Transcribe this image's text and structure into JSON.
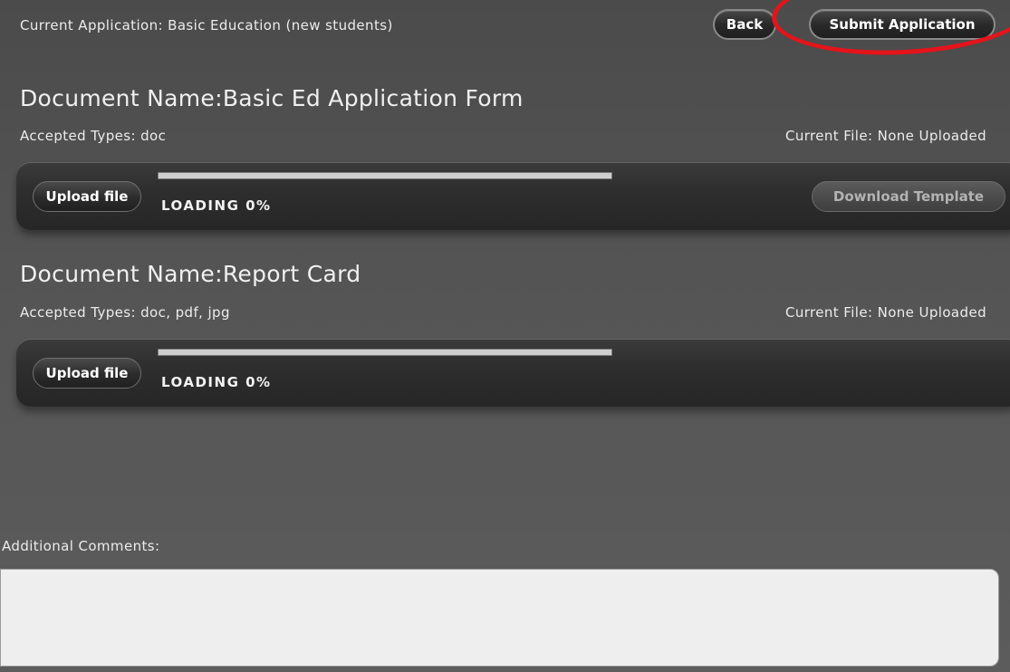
{
  "header": {
    "current_application": "Current Application: Basic Education (new students)",
    "back_label": "Back",
    "submit_label": "Submit Application"
  },
  "documents": [
    {
      "title": "Document Name:Basic Ed Application Form",
      "accepted_types": "Accepted Types: doc",
      "current_file": "Current File: None Uploaded",
      "upload_label": "Upload file",
      "loading_text": "LOADING 0%",
      "progress": 0,
      "download_template_label": "Download Template"
    },
    {
      "title": "Document Name:Report Card",
      "accepted_types": "Accepted Types: doc, pdf, jpg",
      "current_file": "Current File: None Uploaded",
      "upload_label": "Upload file",
      "loading_text": "LOADING 0%",
      "progress": 0
    }
  ],
  "comments": {
    "label": "Additional Comments:",
    "value": ""
  },
  "colors": {
    "highlight": "#e4141a",
    "panel_bg": "#555555"
  }
}
